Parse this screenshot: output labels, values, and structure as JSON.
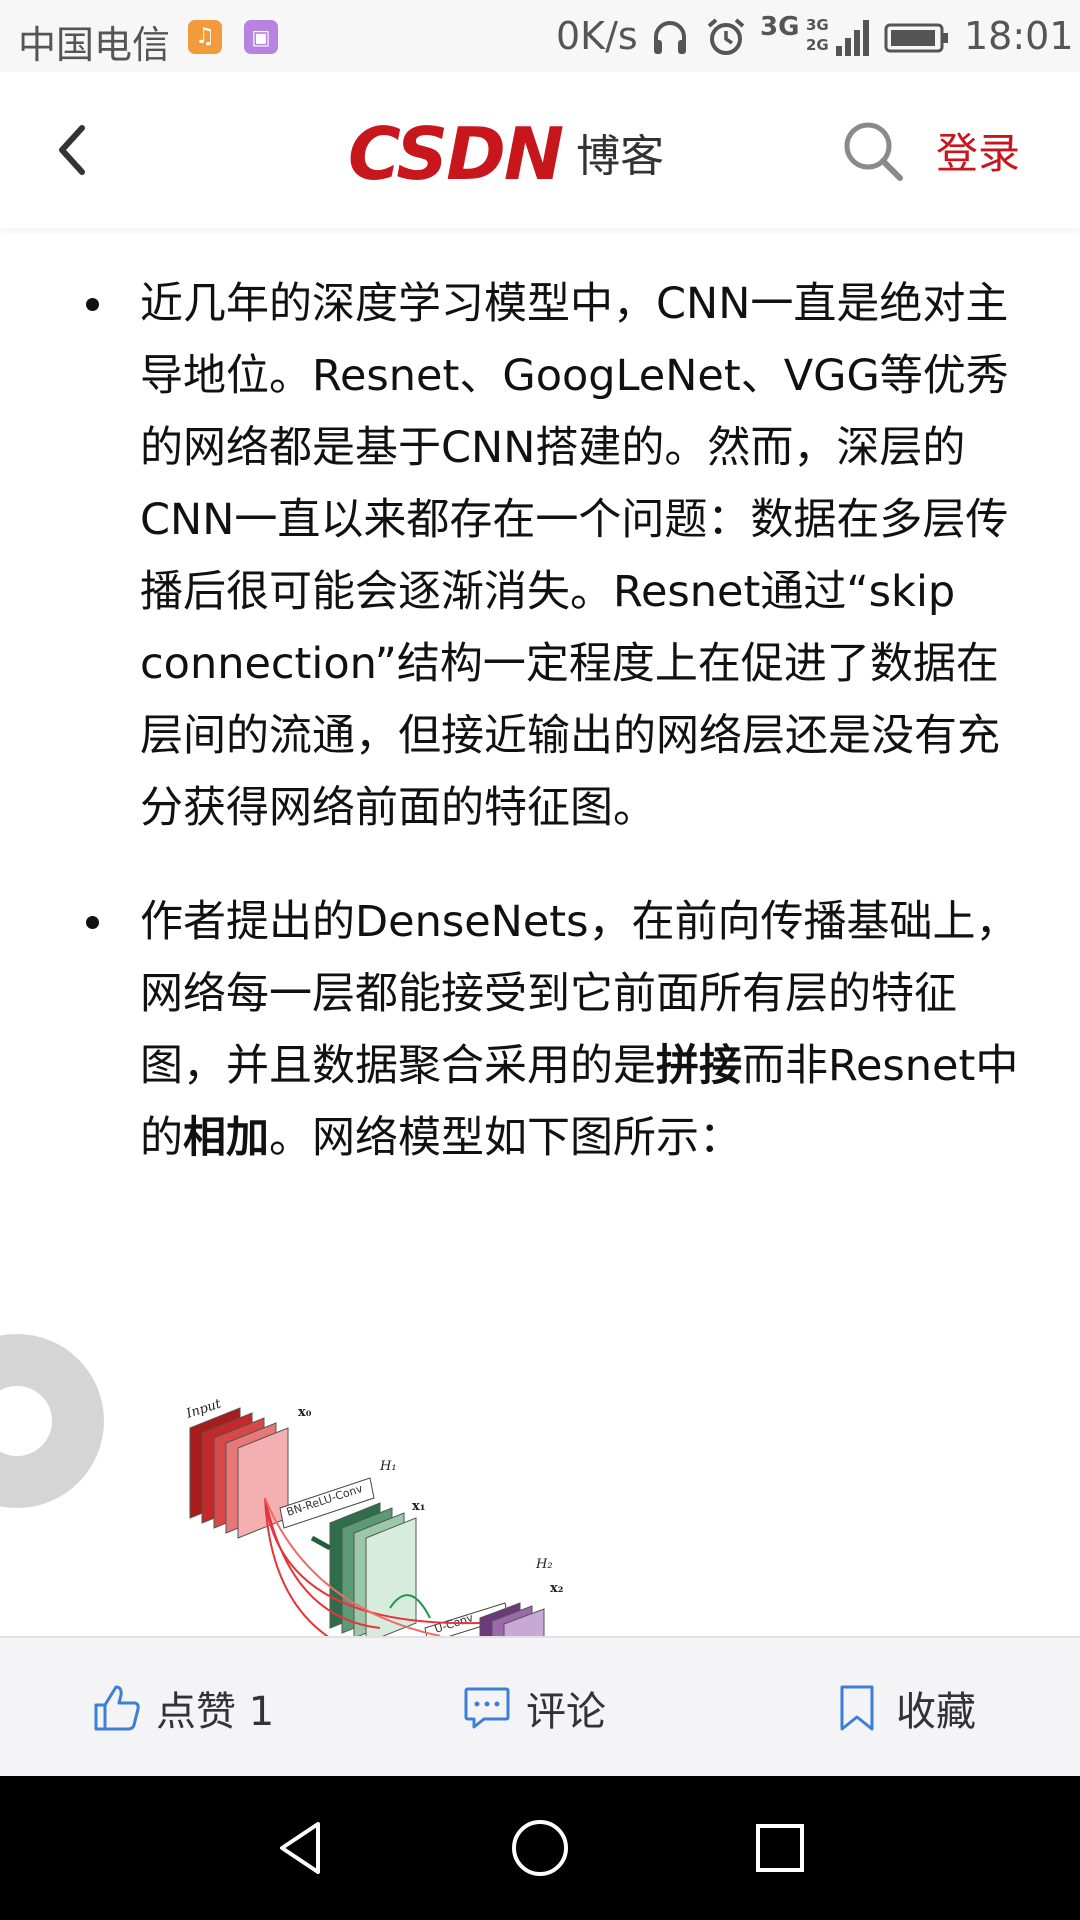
{
  "status_bar": {
    "carrier": "中国电信",
    "speed": "0K/s",
    "network": "3G",
    "network_secondary": "3G 2G",
    "time": "18:01",
    "icons": [
      "music-app-icon",
      "gallery-app-icon",
      "headset-icon",
      "alarm-icon",
      "signal-icon",
      "battery-icon"
    ]
  },
  "header": {
    "logo_text": "CSDN",
    "logo_suffix": "博客",
    "login_label": "登录",
    "icons": [
      "back-icon",
      "search-icon"
    ]
  },
  "article": {
    "bullets": [
      {
        "text": "近几年的深度学习模型中，CNN一直是绝对主导地位。Resnet、GoogLeNet、VGG等优秀的网络都是基于CNN搭建的。然而，深层的CNN一直以来都存在一个问题：数据在多层传播后很可能会逐渐消失。Resnet通过“skip connection”结构一定程度上在促进了数据在层间的流通，但接近输出的网络层还是没有充分获得网络前面的特征图。"
      },
      {
        "part1": "作者提出的DenseNets，在前向传播基础上，网络每一层都能接受到它前面所有层的特征图，并且数据聚合采用的是",
        "bold1": "拼接",
        "part2": "而非Resnet中的",
        "bold2": "相加",
        "part3": "。网络模型如下图所示："
      }
    ],
    "figure": {
      "labels": [
        "Input",
        "x₀",
        "H₁",
        "x₁",
        "H₂",
        "x₂",
        "BN-ReLU-Conv",
        "U-Conv"
      ]
    }
  },
  "actions": {
    "like_label": "点赞 1",
    "comment_label": "评论",
    "collect_label": "收藏",
    "accent": "#3d7fd6"
  },
  "nav_bar": {
    "icons": [
      "nav-back-icon",
      "nav-home-icon",
      "nav-recent-icon"
    ]
  }
}
